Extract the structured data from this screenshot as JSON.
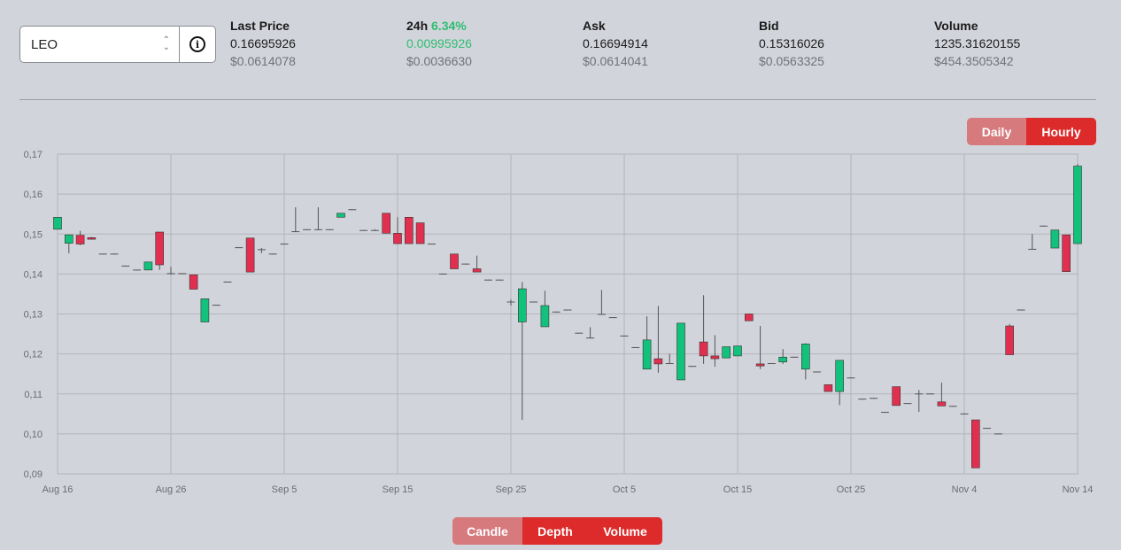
{
  "selector": {
    "value": "LEO"
  },
  "stats": {
    "last_price": {
      "label": "Last Price",
      "value": "0.16695926",
      "usd": "$0.0614078"
    },
    "change_24h": {
      "label": "24h",
      "percent": "6.34%",
      "value": "0.00995926",
      "usd": "$0.0036630"
    },
    "ask": {
      "label": "Ask",
      "value": "0.16694914",
      "usd": "$0.0614041"
    },
    "bid": {
      "label": "Bid",
      "value": "0.15316026",
      "usd": "$0.0563325"
    },
    "volume": {
      "label": "Volume",
      "value": "1235.31620155",
      "usd": "$454.3505342"
    }
  },
  "interval_toggle": {
    "daily": "Daily",
    "hourly": "Hourly"
  },
  "view_toggle": {
    "candle": "Candle",
    "depth": "Depth",
    "volume": "Volume"
  },
  "colors": {
    "up": "#12c17b",
    "down": "#e1304f",
    "accent": "#dd2a2a",
    "accent_light": "#d67a7e",
    "background": "#d2d4db"
  },
  "chart_data": {
    "type": "candlestick",
    "x_ticks": [
      "Aug 16",
      "Aug 26",
      "Sep 5",
      "Sep 15",
      "Sep 25",
      "Oct 5",
      "Oct 15",
      "Oct 25",
      "Nov 4",
      "Nov 14"
    ],
    "y_ticks": [
      "0,09",
      "0,10",
      "0,11",
      "0,12",
      "0,13",
      "0,14",
      "0,15",
      "0,16",
      "0,17"
    ],
    "ylim": [
      0.09,
      0.17
    ],
    "grid": true,
    "start_date": "Aug 16",
    "candles": [
      {
        "o": 0.1512,
        "h": 0.1542,
        "l": 0.1512,
        "c": 0.1542
      },
      {
        "o": 0.1477,
        "h": 0.1498,
        "l": 0.1452,
        "c": 0.1498
      },
      {
        "o": 0.1497,
        "h": 0.1508,
        "l": 0.1472,
        "c": 0.1475
      },
      {
        "o": 0.1491,
        "h": 0.1493,
        "l": 0.1486,
        "c": 0.1487
      },
      {
        "o": 0.1451,
        "h": 0.1451,
        "l": 0.1449,
        "c": 0.1449
      },
      {
        "o": 0.1451,
        "h": 0.1451,
        "l": 0.1449,
        "c": 0.1449
      },
      {
        "o": 0.1421,
        "h": 0.1421,
        "l": 0.1419,
        "c": 0.1419
      },
      {
        "o": 0.1411,
        "h": 0.1411,
        "l": 0.1409,
        "c": 0.1409
      },
      {
        "o": 0.141,
        "h": 0.143,
        "l": 0.141,
        "c": 0.143
      },
      {
        "o": 0.1505,
        "h": 0.1505,
        "l": 0.141,
        "c": 0.1423
      },
      {
        "o": 0.1402,
        "h": 0.1418,
        "l": 0.1399,
        "c": 0.1399
      },
      {
        "o": 0.1402,
        "h": 0.1402,
        "l": 0.1399,
        "c": 0.1399
      },
      {
        "o": 0.1398,
        "h": 0.1398,
        "l": 0.1362,
        "c": 0.1362
      },
      {
        "o": 0.128,
        "h": 0.1338,
        "l": 0.128,
        "c": 0.1338
      },
      {
        "o": 0.1323,
        "h": 0.1323,
        "l": 0.1321,
        "c": 0.1321
      },
      {
        "o": 0.1381,
        "h": 0.1381,
        "l": 0.1379,
        "c": 0.1379
      },
      {
        "o": 0.1467,
        "h": 0.1467,
        "l": 0.1465,
        "c": 0.1465
      },
      {
        "o": 0.149,
        "h": 0.149,
        "l": 0.1405,
        "c": 0.1405
      },
      {
        "o": 0.1462,
        "h": 0.1465,
        "l": 0.1452,
        "c": 0.146
      },
      {
        "o": 0.1451,
        "h": 0.1451,
        "l": 0.1449,
        "c": 0.1449
      },
      {
        "o": 0.1476,
        "h": 0.1476,
        "l": 0.1474,
        "c": 0.1474
      },
      {
        "o": 0.1507,
        "h": 0.1567,
        "l": 0.1505,
        "c": 0.1505
      },
      {
        "o": 0.1512,
        "h": 0.1512,
        "l": 0.151,
        "c": 0.151
      },
      {
        "o": 0.1512,
        "h": 0.1567,
        "l": 0.151,
        "c": 0.151
      },
      {
        "o": 0.1512,
        "h": 0.1512,
        "l": 0.151,
        "c": 0.151
      },
      {
        "o": 0.1542,
        "h": 0.1552,
        "l": 0.1542,
        "c": 0.1552
      },
      {
        "o": 0.1562,
        "h": 0.1562,
        "l": 0.156,
        "c": 0.156
      },
      {
        "o": 0.151,
        "h": 0.151,
        "l": 0.1508,
        "c": 0.1508
      },
      {
        "o": 0.151,
        "h": 0.1512,
        "l": 0.1508,
        "c": 0.1508
      },
      {
        "o": 0.1552,
        "h": 0.1552,
        "l": 0.1502,
        "c": 0.1502
      },
      {
        "o": 0.1502,
        "h": 0.1542,
        "l": 0.1476,
        "c": 0.1476
      },
      {
        "o": 0.1542,
        "h": 0.1542,
        "l": 0.1476,
        "c": 0.1476
      },
      {
        "o": 0.1528,
        "h": 0.1528,
        "l": 0.1476,
        "c": 0.1476
      },
      {
        "o": 0.1476,
        "h": 0.1476,
        "l": 0.1474,
        "c": 0.1474
      },
      {
        "o": 0.1401,
        "h": 0.1401,
        "l": 0.1399,
        "c": 0.1399
      },
      {
        "o": 0.145,
        "h": 0.145,
        "l": 0.1413,
        "c": 0.1413
      },
      {
        "o": 0.1426,
        "h": 0.1426,
        "l": 0.1424,
        "c": 0.1424
      },
      {
        "o": 0.1413,
        "h": 0.1446,
        "l": 0.1405,
        "c": 0.1405
      },
      {
        "o": 0.1386,
        "h": 0.1386,
        "l": 0.1384,
        "c": 0.1384
      },
      {
        "o": 0.1386,
        "h": 0.1386,
        "l": 0.1384,
        "c": 0.1384
      },
      {
        "o": 0.1331,
        "h": 0.1336,
        "l": 0.1321,
        "c": 0.1331
      },
      {
        "o": 0.128,
        "h": 0.138,
        "l": 0.1035,
        "c": 0.1363
      },
      {
        "o": 0.1331,
        "h": 0.1331,
        "l": 0.1329,
        "c": 0.1329
      },
      {
        "o": 0.1268,
        "h": 0.1358,
        "l": 0.1268,
        "c": 0.1321
      },
      {
        "o": 0.1306,
        "h": 0.1306,
        "l": 0.1304,
        "c": 0.1304
      },
      {
        "o": 0.1311,
        "h": 0.1311,
        "l": 0.1309,
        "c": 0.1309
      },
      {
        "o": 0.1253,
        "h": 0.1253,
        "l": 0.1251,
        "c": 0.1251
      },
      {
        "o": 0.1241,
        "h": 0.1267,
        "l": 0.1239,
        "c": 0.1239
      },
      {
        "o": 0.13,
        "h": 0.136,
        "l": 0.13,
        "c": 0.13
      },
      {
        "o": 0.1292,
        "h": 0.1292,
        "l": 0.129,
        "c": 0.129
      },
      {
        "o": 0.1246,
        "h": 0.1246,
        "l": 0.1244,
        "c": 0.1244
      },
      {
        "o": 0.1217,
        "h": 0.1217,
        "l": 0.1215,
        "c": 0.1215
      },
      {
        "o": 0.1162,
        "h": 0.1294,
        "l": 0.1162,
        "c": 0.1235
      },
      {
        "o": 0.1188,
        "h": 0.132,
        "l": 0.1153,
        "c": 0.1175
      },
      {
        "o": 0.1177,
        "h": 0.12,
        "l": 0.1175,
        "c": 0.1175
      },
      {
        "o": 0.1135,
        "h": 0.1277,
        "l": 0.1135,
        "c": 0.1277
      },
      {
        "o": 0.117,
        "h": 0.117,
        "l": 0.1168,
        "c": 0.1168
      },
      {
        "o": 0.123,
        "h": 0.1347,
        "l": 0.1175,
        "c": 0.1195
      },
      {
        "o": 0.1195,
        "h": 0.1247,
        "l": 0.1168,
        "c": 0.1188
      },
      {
        "o": 0.119,
        "h": 0.1218,
        "l": 0.119,
        "c": 0.1218
      },
      {
        "o": 0.1195,
        "h": 0.122,
        "l": 0.1195,
        "c": 0.122
      },
      {
        "o": 0.13,
        "h": 0.13,
        "l": 0.1283,
        "c": 0.1283
      },
      {
        "o": 0.1175,
        "h": 0.127,
        "l": 0.1162,
        "c": 0.117
      },
      {
        "o": 0.1177,
        "h": 0.1177,
        "l": 0.1175,
        "c": 0.1175
      },
      {
        "o": 0.118,
        "h": 0.1212,
        "l": 0.1175,
        "c": 0.1192
      },
      {
        "o": 0.1193,
        "h": 0.1193,
        "l": 0.1191,
        "c": 0.1191
      },
      {
        "o": 0.1162,
        "h": 0.1227,
        "l": 0.1136,
        "c": 0.1225
      },
      {
        "o": 0.1156,
        "h": 0.1156,
        "l": 0.1154,
        "c": 0.1154
      },
      {
        "o": 0.1123,
        "h": 0.1123,
        "l": 0.1106,
        "c": 0.1106
      },
      {
        "o": 0.1106,
        "h": 0.1184,
        "l": 0.1072,
        "c": 0.1184
      },
      {
        "o": 0.1141,
        "h": 0.1141,
        "l": 0.1139,
        "c": 0.1139
      },
      {
        "o": 0.1088,
        "h": 0.1088,
        "l": 0.1086,
        "c": 0.1086
      },
      {
        "o": 0.109,
        "h": 0.109,
        "l": 0.1088,
        "c": 0.1088
      },
      {
        "o": 0.1055,
        "h": 0.1055,
        "l": 0.1053,
        "c": 0.1053
      },
      {
        "o": 0.1118,
        "h": 0.1118,
        "l": 0.1071,
        "c": 0.1071
      },
      {
        "o": 0.1077,
        "h": 0.1077,
        "l": 0.1075,
        "c": 0.1075
      },
      {
        "o": 0.1101,
        "h": 0.111,
        "l": 0.1055,
        "c": 0.1099
      },
      {
        "o": 0.1101,
        "h": 0.1101,
        "l": 0.1099,
        "c": 0.1099
      },
      {
        "o": 0.108,
        "h": 0.1128,
        "l": 0.107,
        "c": 0.107
      },
      {
        "o": 0.107,
        "h": 0.107,
        "l": 0.1068,
        "c": 0.1068
      },
      {
        "o": 0.1051,
        "h": 0.1051,
        "l": 0.1049,
        "c": 0.1049
      },
      {
        "o": 0.1035,
        "h": 0.1035,
        "l": 0.0915,
        "c": 0.0915
      },
      {
        "o": 0.1015,
        "h": 0.1015,
        "l": 0.1013,
        "c": 0.1013
      },
      {
        "o": 0.1001,
        "h": 0.1001,
        "l": 0.0999,
        "c": 0.0999
      },
      {
        "o": 0.127,
        "h": 0.1275,
        "l": 0.1198,
        "c": 0.1198
      },
      {
        "o": 0.1311,
        "h": 0.1311,
        "l": 0.1309,
        "c": 0.1309
      },
      {
        "o": 0.1463,
        "h": 0.15,
        "l": 0.1463,
        "c": 0.1463
      },
      {
        "o": 0.1521,
        "h": 0.1521,
        "l": 0.1519,
        "c": 0.1519
      },
      {
        "o": 0.1465,
        "h": 0.151,
        "l": 0.1465,
        "c": 0.151
      },
      {
        "o": 0.1498,
        "h": 0.1498,
        "l": 0.1406,
        "c": 0.1406
      },
      {
        "o": 0.1476,
        "h": 0.1675,
        "l": 0.1476,
        "c": 0.167
      }
    ]
  }
}
